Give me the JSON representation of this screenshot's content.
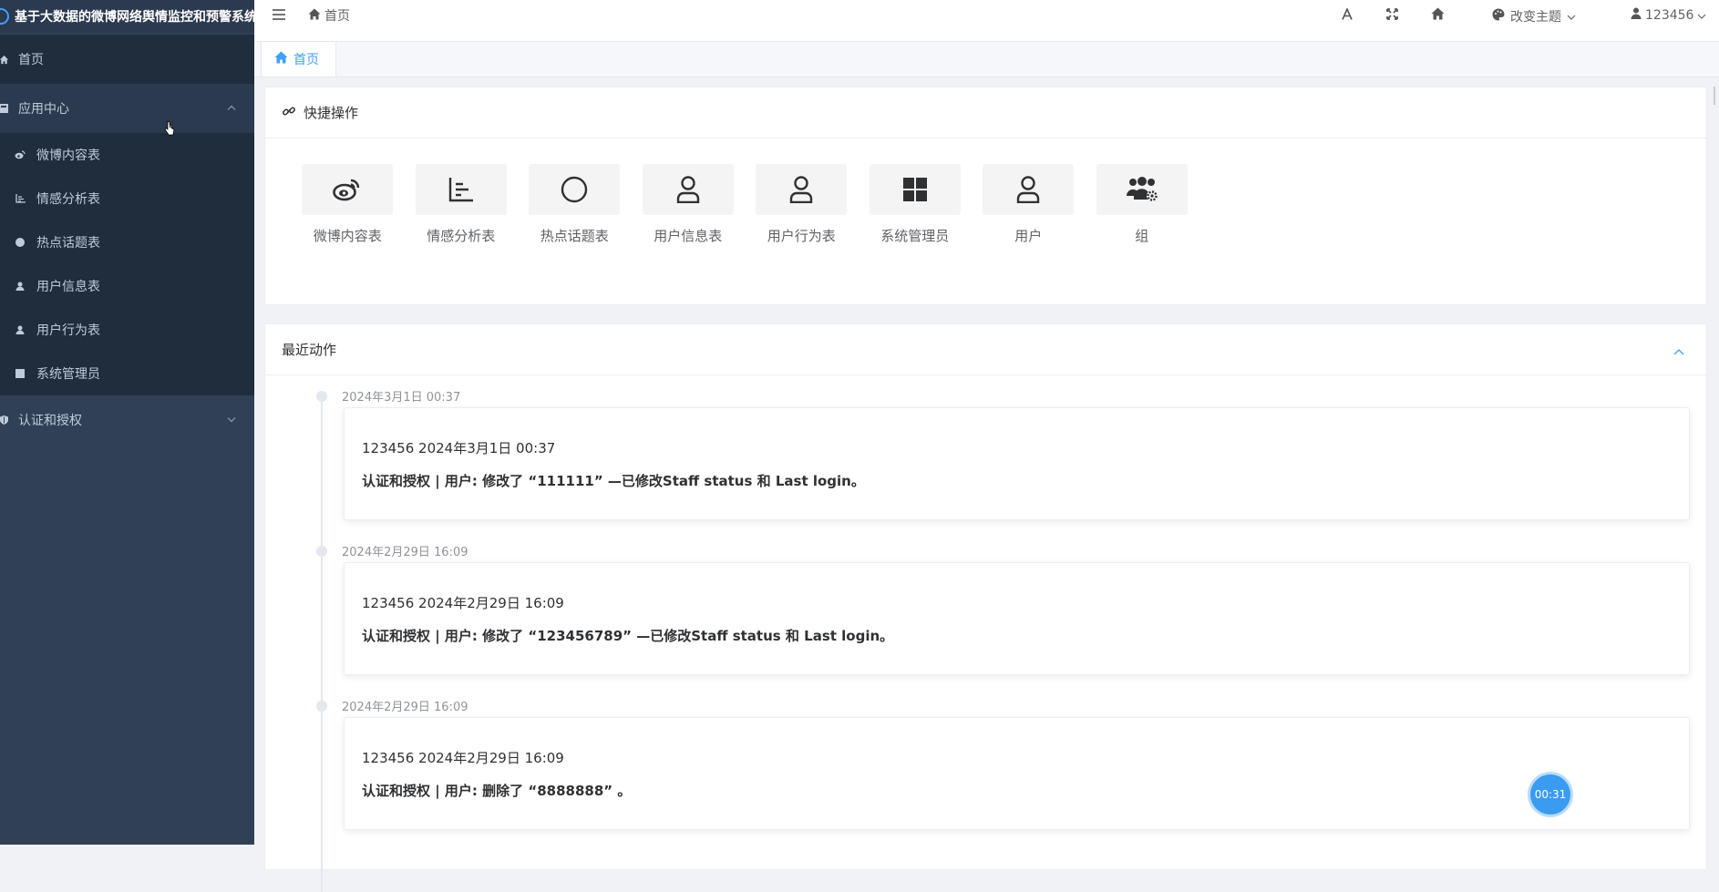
{
  "app": {
    "title": "基于大数据的微博网络舆情监控和预警系统"
  },
  "sidebar": {
    "home": "首页",
    "app_center": {
      "label": "应用中心",
      "items": [
        {
          "label": "微博内容表",
          "icon": "weibo-icon"
        },
        {
          "label": "情感分析表",
          "icon": "chart-icon"
        },
        {
          "label": "热点话题表",
          "icon": "circle-icon"
        },
        {
          "label": "用户信息表",
          "icon": "user-icon"
        },
        {
          "label": "用户行为表",
          "icon": "user-icon"
        },
        {
          "label": "系统管理员",
          "icon": "square-icon"
        }
      ]
    },
    "auth": {
      "label": "认证和授权"
    }
  },
  "header": {
    "breadcrumb": "首页",
    "theme_label": "改变主题",
    "user_name": "123456"
  },
  "tabs": [
    {
      "label": "首页"
    }
  ],
  "quick_actions": {
    "title": "快捷操作",
    "items": [
      {
        "label": "微博内容表",
        "icon": "weibo-icon"
      },
      {
        "label": "情感分析表",
        "icon": "chart-icon"
      },
      {
        "label": "热点话题表",
        "icon": "circle-icon"
      },
      {
        "label": "用户信息表",
        "icon": "user-icon"
      },
      {
        "label": "用户行为表",
        "icon": "user-icon"
      },
      {
        "label": "系统管理员",
        "icon": "windows-icon"
      },
      {
        "label": "用户",
        "icon": "user-icon"
      },
      {
        "label": "组",
        "icon": "users-gear-icon"
      }
    ]
  },
  "recent": {
    "title": "最近动作",
    "entries": [
      {
        "time": "2024年3月1日 00:37",
        "line1": "123456 2024年3月1日 00:37",
        "line2": "认证和授权 | 用户: 修改了 “111111” —已修改Staff status 和 Last login。"
      },
      {
        "time": "2024年2月29日 16:09",
        "line1": "123456 2024年2月29日 16:09",
        "line2": "认证和授权 | 用户: 修改了 “123456789” —已修改Staff status 和 Last login。"
      },
      {
        "time": "2024年2月29日 16:09",
        "line1": "123456 2024年2月29日 16:09",
        "line2": "认证和授权 | 用户: 删除了 “8888888” 。"
      }
    ]
  },
  "timer_badge": "00:31",
  "colors": {
    "sidebar_bg": "#304156",
    "accent": "#409eff",
    "badge": "#3a9bf0"
  }
}
